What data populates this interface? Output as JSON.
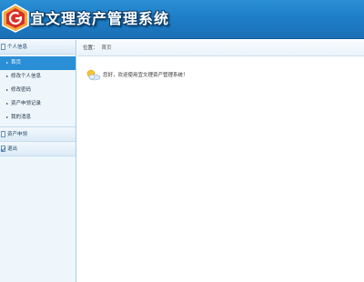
{
  "header": {
    "title": "宜文理资产管理系统",
    "logo_icon": "app-logo-icon",
    "bg_color": "#1e7fc8"
  },
  "sidebar": {
    "groups": [
      {
        "label": "个人信息",
        "icon": "folder-icon",
        "items": [
          {
            "label": "首页",
            "active": true
          },
          {
            "label": "修改个人信息",
            "active": false
          },
          {
            "label": "修改密码",
            "active": false
          },
          {
            "label": "资产申领记录",
            "active": false
          },
          {
            "label": "我的消息",
            "active": false
          }
        ]
      },
      {
        "label": "资产申领",
        "icon": "folder-icon",
        "items": []
      },
      {
        "label": "退出",
        "icon": "checkbox-icon",
        "items": []
      }
    ],
    "active_color": "#2a8fd6"
  },
  "main": {
    "breadcrumb_label": "位置：",
    "breadcrumb_current": "首页",
    "welcome_text": "您好，欢迎使用宜文理资产管理系统！",
    "welcome_icon": "weather-sun-cloud-icon"
  }
}
